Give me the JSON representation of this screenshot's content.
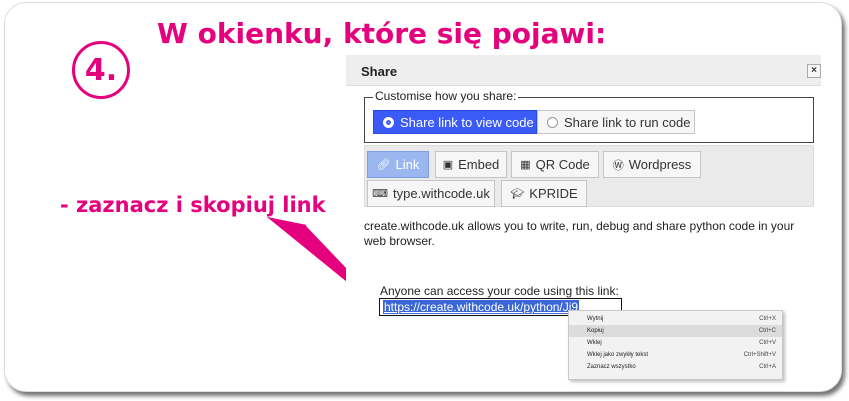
{
  "step": {
    "number": "4."
  },
  "headline": "W okienku, które się pojawi:",
  "instruction": "- zaznacz i skopiuj link",
  "colors": {
    "accent": "#e5007e",
    "selected_blue": "#3b5bf6",
    "tab_active": "#9bb7ef"
  },
  "dialog": {
    "title": "Share",
    "close_label": "×",
    "fieldset_legend": "Customise how you share:",
    "radio_options": [
      {
        "label": "Share link to view code",
        "selected": true
      },
      {
        "label": "Share link to run code",
        "selected": false
      }
    ],
    "tabs": [
      {
        "label": "Link",
        "icon": "link-icon",
        "glyph": "🔗︎"
      },
      {
        "label": "Embed",
        "icon": "embed-icon",
        "glyph": "▣"
      },
      {
        "label": "QR Code",
        "icon": "qr-code-icon",
        "glyph": "▦"
      },
      {
        "label": "Wordpress",
        "icon": "wordpress-icon",
        "glyph": "Ⓦ"
      },
      {
        "label": "type.withcode.uk",
        "icon": "keyboard-icon",
        "glyph": "⌨"
      },
      {
        "label": "KPRIDE",
        "icon": "graduation-cap-icon",
        "glyph": "🎓︎"
      }
    ],
    "description": "create.withcode.uk allows you to write, run, debug and share python code in your web browser.",
    "access_label": "Anyone can access your code using this link:",
    "link_value": "https://create.withcode.uk/python/Ji9"
  },
  "context_menu": {
    "items": [
      {
        "label": "Wytnij",
        "shortcut": "Ctrl+X",
        "highlighted": false
      },
      {
        "label": "Kopiuj",
        "shortcut": "Ctrl+C",
        "highlighted": true
      },
      {
        "label": "Wklej",
        "shortcut": "Ctrl+V",
        "highlighted": false
      },
      {
        "label": "Wklej jako zwykły tekst",
        "shortcut": "Ctrl+Shift+V",
        "highlighted": false
      },
      {
        "label": "Zaznacz wszystko",
        "shortcut": "Ctrl+A",
        "highlighted": false
      }
    ]
  }
}
